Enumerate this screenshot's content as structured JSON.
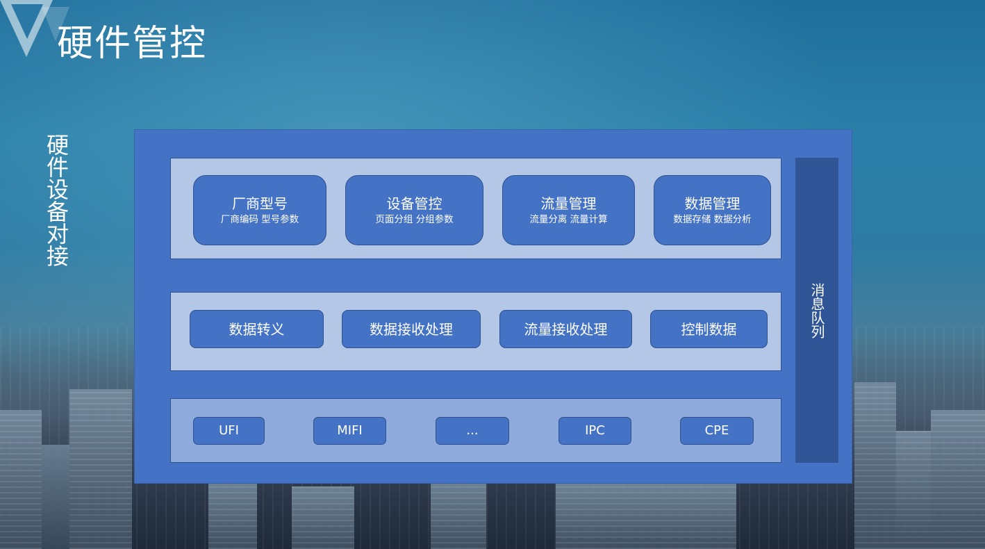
{
  "title": "硬件管控",
  "side_label": "硬件设备对接",
  "top_layer": [
    {
      "title": "厂商型号",
      "subtitle": "厂商编码  型号参数"
    },
    {
      "title": "设备管控",
      "subtitle": "页面分组  分组参数"
    },
    {
      "title": "流量管理",
      "subtitle": "流量分离  流量计算"
    },
    {
      "title": "数据管理",
      "subtitle": "数据存储  数据分析"
    }
  ],
  "middle_layer": [
    "数据转义",
    "数据接收处理",
    "流量接收处理",
    "控制数据"
  ],
  "bottom_layer": [
    "UFI",
    "MIFI",
    "...",
    "IPC",
    "CPE"
  ],
  "message_queue": "消息队列",
  "colors": {
    "panel": "#4472c4",
    "layer": "#b4c7e7",
    "bottom_layer": "#8faadc",
    "queue": "#2f5597",
    "border": "#2f528f"
  }
}
